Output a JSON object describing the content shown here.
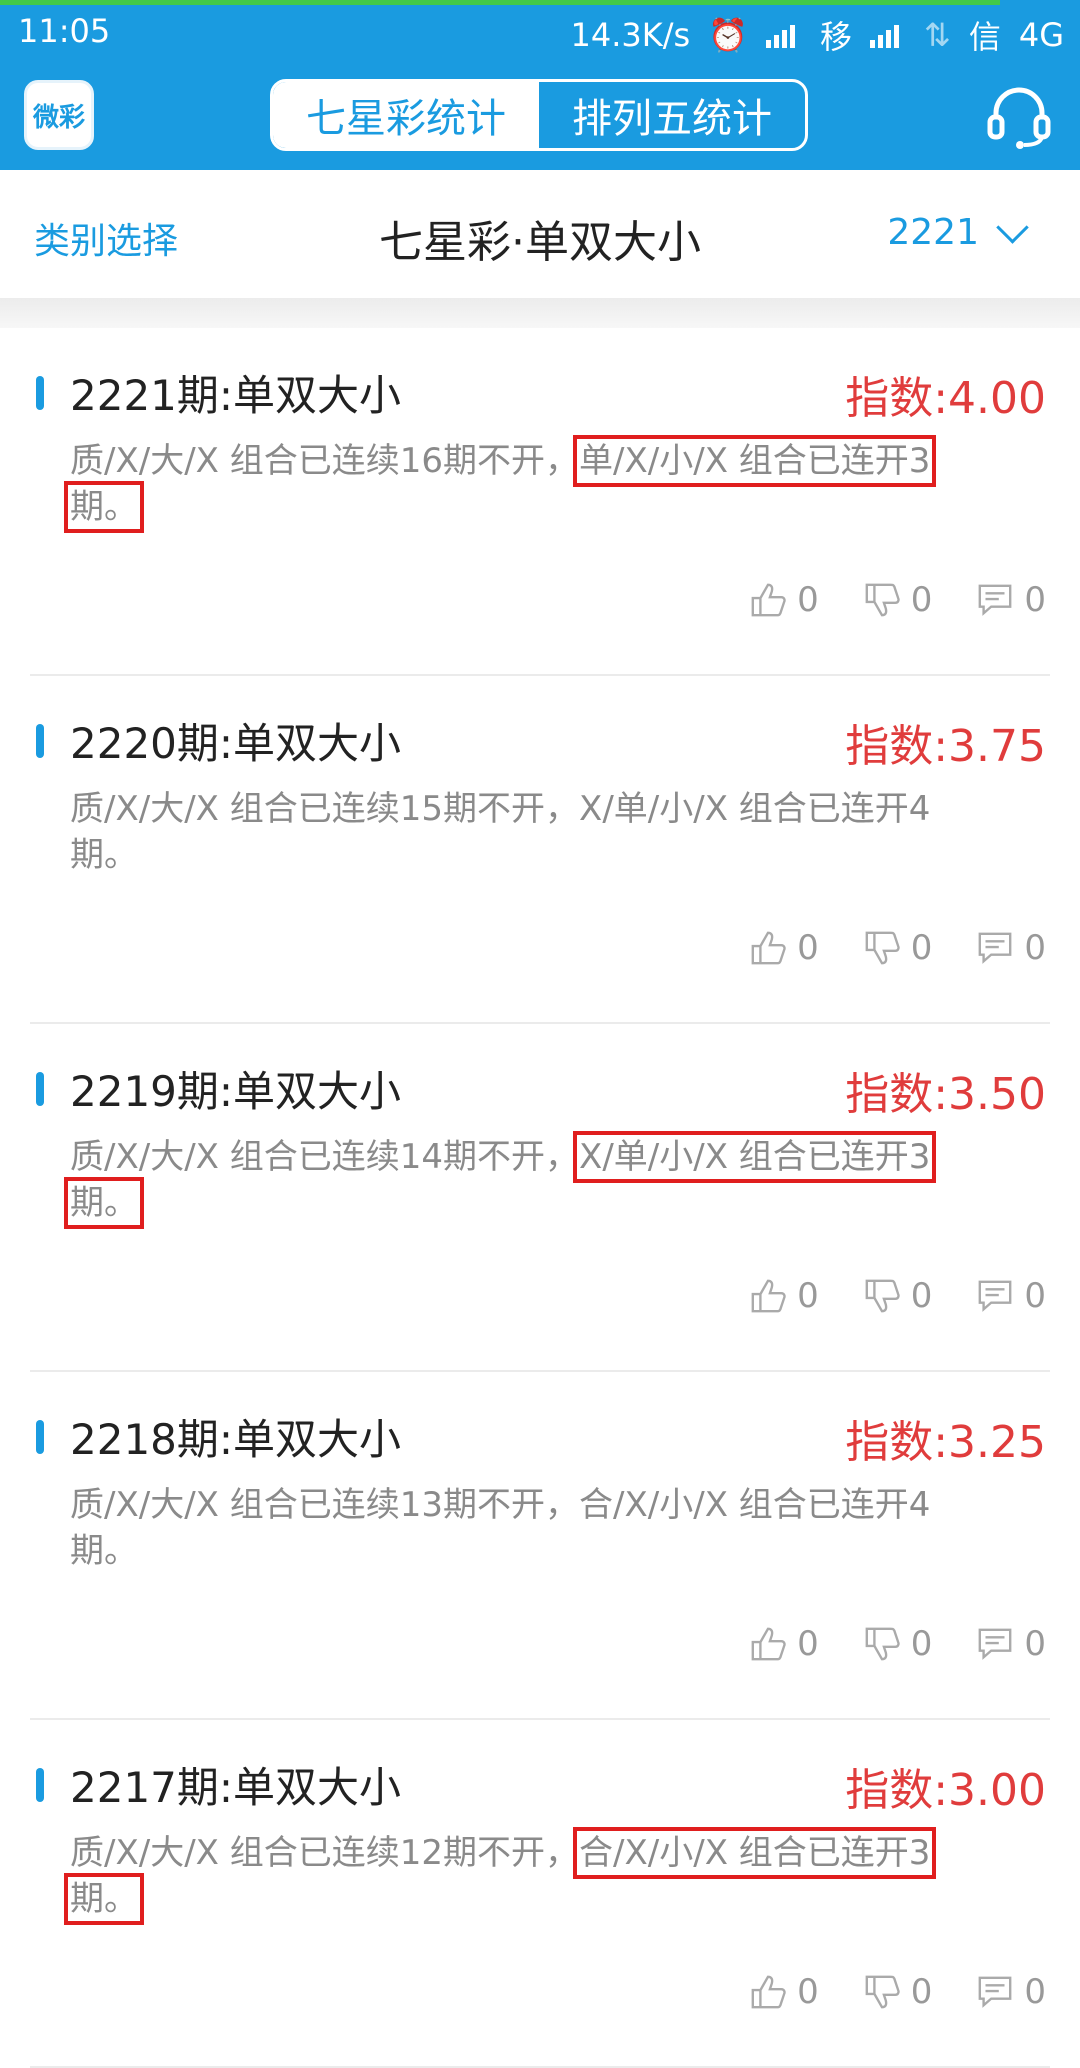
{
  "status": {
    "time": "11:05",
    "net_speed": "14.3K/s",
    "carrier1": "移",
    "carrier2": "信",
    "network": "4G"
  },
  "appbar": {
    "logo_text": "微彩",
    "tabs": [
      {
        "label": "七星彩统计",
        "active": true
      },
      {
        "label": "排列五统计",
        "active": false
      }
    ]
  },
  "subheader": {
    "category_label": "类别选择",
    "title": "七星彩·单双大小",
    "period": "2221"
  },
  "items": [
    {
      "title": "2221期:单双大小",
      "index": "指数:4.00",
      "desc_a": "质/X/大/X 组合已连续16期不开，",
      "desc_b": "单/X/小/X 组合已连开3",
      "desc_c": "期。",
      "likes": "0",
      "dislikes": "0",
      "comments": "0"
    },
    {
      "title": "2220期:单双大小",
      "index": "指数:3.75",
      "desc_a": "质/X/大/X 组合已连续15期不开，",
      "desc_b": "X/单/小/X 组合已连开4",
      "desc_c": "期。",
      "likes": "0",
      "dislikes": "0",
      "comments": "0"
    },
    {
      "title": "2219期:单双大小",
      "index": "指数:3.50",
      "desc_a": "质/X/大/X 组合已连续14期不开，",
      "desc_b": "X/单/小/X 组合已连开3",
      "desc_c": "期。",
      "likes": "0",
      "dislikes": "0",
      "comments": "0"
    },
    {
      "title": "2218期:单双大小",
      "index": "指数:3.25",
      "desc_a": "质/X/大/X 组合已连续13期不开，",
      "desc_b": "合/X/小/X 组合已连开4",
      "desc_c": "期。",
      "likes": "0",
      "dislikes": "0",
      "comments": "0"
    },
    {
      "title": "2217期:单双大小",
      "index": "指数:3.00",
      "desc_a": "质/X/大/X 组合已连续12期不开，",
      "desc_b": "合/X/小/X 组合已连开3",
      "desc_c": "期。",
      "likes": "0",
      "dislikes": "0",
      "comments": "0"
    }
  ],
  "colors": {
    "primary": "#1a9be0",
    "index_red": "#e03c3c",
    "highlight_box": "#e01e1e"
  }
}
